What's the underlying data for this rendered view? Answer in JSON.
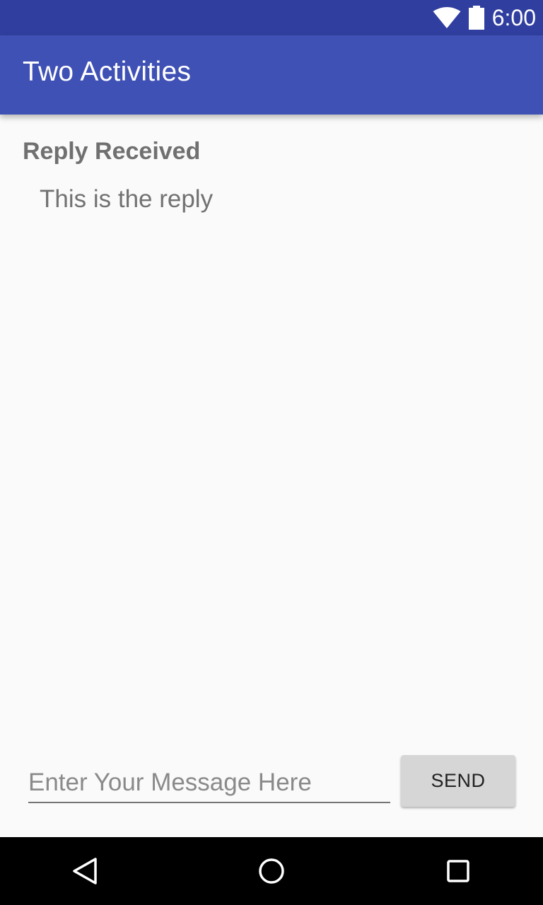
{
  "status_bar": {
    "time": "6:00",
    "icons": [
      "wifi-icon",
      "battery-icon"
    ],
    "background": "#303f9f"
  },
  "app_bar": {
    "title": "Two Activities",
    "background": "#3f51b5"
  },
  "reply": {
    "header": "Reply Received",
    "text": "This is the reply"
  },
  "compose": {
    "placeholder": "Enter Your Message Here",
    "value": "",
    "send_label": "SEND"
  },
  "nav_bar": {
    "buttons": [
      "back-icon",
      "home-icon",
      "recents-icon"
    ]
  }
}
